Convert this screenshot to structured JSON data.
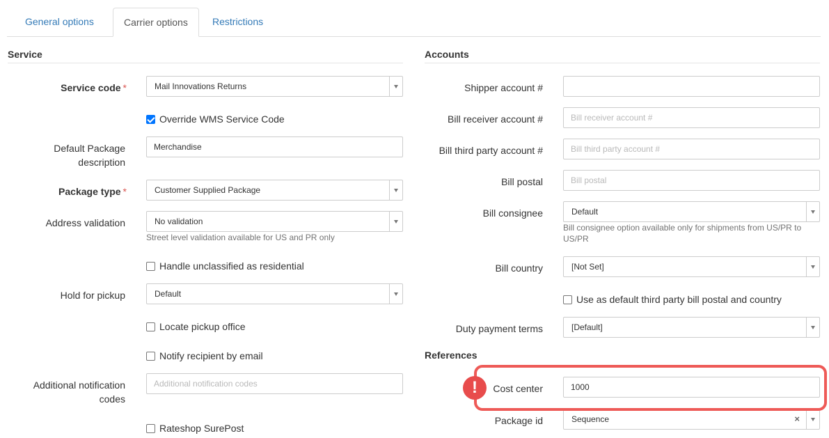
{
  "tabs": [
    {
      "label": "General options",
      "active": false
    },
    {
      "label": "Carrier options",
      "active": true
    },
    {
      "label": "Restrictions",
      "active": false
    }
  ],
  "service": {
    "title": "Service",
    "service_code": {
      "label": "Service code",
      "required": "*",
      "value": "Mail Innovations Returns"
    },
    "override_wms": {
      "label": "Override WMS Service Code",
      "checked": true
    },
    "default_package_description": {
      "label_line1": "Default Package",
      "label_line2": "description",
      "value": "Merchandise"
    },
    "package_type": {
      "label": "Package type",
      "required": "*",
      "value": "Customer Supplied Package"
    },
    "address_validation": {
      "label": "Address validation",
      "value": "No validation",
      "help": "Street level validation available for US and PR only"
    },
    "handle_unclassified": {
      "label": "Handle unclassified as residential",
      "checked": false
    },
    "hold_for_pickup": {
      "label": "Hold for pickup",
      "value": "Default"
    },
    "locate_pickup_office": {
      "label": "Locate pickup office",
      "checked": false
    },
    "notify_recipient": {
      "label": "Notify recipient by email",
      "checked": false
    },
    "additional_notification_codes": {
      "label_line1": "Additional notification",
      "label_line2": "codes",
      "placeholder": "Additional notification codes"
    },
    "rateshop_surepost": {
      "label": "Rateshop SurePost",
      "checked": false
    }
  },
  "accounts": {
    "title": "Accounts",
    "shipper_account": {
      "label": "Shipper account #",
      "value": ""
    },
    "bill_receiver_account": {
      "label": "Bill receiver account #",
      "placeholder": "Bill receiver account #"
    },
    "bill_third_party_account": {
      "label": "Bill third party account #",
      "placeholder": "Bill third party account #"
    },
    "bill_postal": {
      "label": "Bill postal",
      "placeholder": "Bill postal"
    },
    "bill_consignee": {
      "label": "Bill consignee",
      "value": "Default",
      "help_line1": "Bill consignee option available only for shipments from US/PR to",
      "help_line2": "US/PR"
    },
    "bill_country": {
      "label": "Bill country",
      "value": "[Not Set]"
    },
    "use_default_third_party": {
      "label": "Use as default third party bill postal and country",
      "checked": false
    },
    "duty_payment_terms": {
      "label": "Duty payment terms",
      "value": "[Default]"
    }
  },
  "references": {
    "title": "References",
    "cost_center": {
      "label": "Cost center",
      "value": "1000"
    },
    "package_id": {
      "label": "Package id",
      "value": "Sequence",
      "clear": "×"
    }
  },
  "warning_icon": {
    "glyph": "!",
    "name": "exclamation-icon",
    "color": "#e84c4c"
  },
  "highlight_color": "#ee5a57"
}
